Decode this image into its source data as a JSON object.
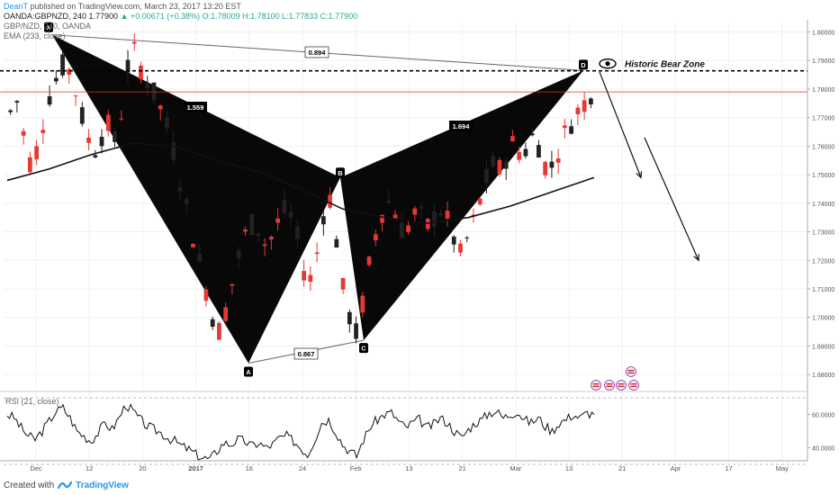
{
  "header": {
    "author": "DeanT",
    "published_text": "published on TradingView.com, March 23, 2017 13:20 EST",
    "symbol_line": "OANDA:GBPNZD, 240  1.77900",
    "change": "▲ +0.00671 (+0.38%)",
    "ohlc": "O:1.78009  H:1.78100  L:1.77833  C:1.77900",
    "symbol_name": "GBP/NZD, 240, OANDA",
    "ema_label": "EMA (233, close)"
  },
  "rsi_label": "RSI (21, close)",
  "footer": {
    "created_with": "Created with",
    "brand": "TradingView"
  },
  "colors": {
    "up": "#26a69a",
    "down": "#e53935",
    "price": "#d32f2f",
    "label_bg": "#000000"
  },
  "chart_data": {
    "type": "candlestick",
    "y_range": [
      1.675,
      1.803
    ],
    "y_ticks": [
      "1.80000",
      "1.79000",
      "1.78000",
      "1.77000",
      "1.76000",
      "1.75000",
      "1.74000",
      "1.73000",
      "1.72000",
      "1.71000",
      "1.70000",
      "1.69000",
      "1.68000"
    ],
    "x_ticks": [
      "Dec",
      "12",
      "20",
      "2017",
      "16",
      "24",
      "Feb",
      "13",
      "21",
      "Mar",
      "13",
      "21",
      "Apr",
      "17",
      "May"
    ],
    "resistance": {
      "value": 1.78638,
      "label": "1.78638",
      "text": "Historic Bear Zone"
    },
    "last_price": {
      "value": 1.779,
      "label": "1.77900",
      "timer": "2:39:36"
    },
    "pattern_points": [
      {
        "name": "X",
        "price": 1.799
      },
      {
        "name": "A",
        "price": 1.684
      },
      {
        "name": "B",
        "price": 1.749
      },
      {
        "name": "C",
        "price": 1.692
      },
      {
        "name": "D",
        "price": 1.7865
      }
    ],
    "ratios": [
      {
        "label": "0.894"
      },
      {
        "label": "1.559"
      },
      {
        "label": "0.867"
      },
      {
        "label": "1.694"
      }
    ],
    "close_path": [
      [
        0,
        1.772
      ],
      [
        1,
        1.776
      ],
      [
        2,
        1.763
      ],
      [
        3,
        1.753
      ],
      [
        4,
        1.76
      ],
      [
        5,
        1.772
      ],
      [
        6,
        1.781
      ],
      [
        7,
        1.785
      ],
      [
        8,
        1.79
      ],
      [
        9,
        1.783
      ],
      [
        10,
        1.774
      ],
      [
        11,
        1.764
      ],
      [
        12,
        1.758
      ],
      [
        13,
        1.763
      ],
      [
        14,
        1.768
      ],
      [
        15,
        1.761
      ],
      [
        16,
        1.771
      ],
      [
        17,
        1.788
      ],
      [
        18,
        1.793
      ],
      [
        19,
        1.787
      ],
      [
        20,
        1.782
      ],
      [
        21,
        1.777
      ],
      [
        22,
        1.772
      ],
      [
        23,
        1.764
      ],
      [
        24,
        1.755
      ],
      [
        25,
        1.743
      ],
      [
        26,
        1.733
      ],
      [
        27,
        1.723
      ],
      [
        28,
        1.713
      ],
      [
        29,
        1.703
      ],
      [
        30,
        1.694
      ],
      [
        31,
        1.701
      ],
      [
        32,
        1.711
      ],
      [
        33,
        1.721
      ],
      [
        34,
        1.729
      ],
      [
        35,
        1.733
      ],
      [
        36,
        1.731
      ],
      [
        37,
        1.725
      ],
      [
        38,
        1.729
      ],
      [
        39,
        1.735
      ],
      [
        40,
        1.738
      ],
      [
        41,
        1.733
      ],
      [
        42,
        1.722
      ],
      [
        43,
        1.711
      ],
      [
        44,
        1.717
      ],
      [
        45,
        1.733
      ],
      [
        46,
        1.745
      ],
      [
        47,
        1.731
      ],
      [
        48,
        1.711
      ],
      [
        49,
        1.701
      ],
      [
        50,
        1.694
      ],
      [
        51,
        1.705
      ],
      [
        52,
        1.719
      ],
      [
        53,
        1.731
      ],
      [
        54,
        1.739
      ],
      [
        55,
        1.741
      ],
      [
        56,
        1.735
      ],
      [
        57,
        1.729
      ],
      [
        58,
        1.734
      ],
      [
        59,
        1.738
      ],
      [
        60,
        1.731
      ],
      [
        61,
        1.733
      ],
      [
        62,
        1.739
      ],
      [
        63,
        1.735
      ],
      [
        64,
        1.729
      ],
      [
        65,
        1.721
      ],
      [
        66,
        1.727
      ],
      [
        67,
        1.733
      ],
      [
        68,
        1.741
      ],
      [
        69,
        1.749
      ],
      [
        70,
        1.754
      ],
      [
        71,
        1.751
      ],
      [
        72,
        1.758
      ],
      [
        73,
        1.762
      ],
      [
        74,
        1.756
      ],
      [
        75,
        1.761
      ],
      [
        76,
        1.765
      ],
      [
        77,
        1.755
      ],
      [
        78,
        1.751
      ],
      [
        79,
        1.757
      ],
      [
        80,
        1.763
      ],
      [
        81,
        1.768
      ],
      [
        82,
        1.772
      ],
      [
        83,
        1.775
      ],
      [
        84,
        1.779
      ]
    ],
    "ema_path": [
      [
        0,
        1.748
      ],
      [
        6,
        1.752
      ],
      [
        12,
        1.757
      ],
      [
        18,
        1.761
      ],
      [
        24,
        1.76
      ],
      [
        30,
        1.755
      ],
      [
        36,
        1.751
      ],
      [
        42,
        1.745
      ],
      [
        48,
        1.738
      ],
      [
        54,
        1.735
      ],
      [
        60,
        1.733
      ],
      [
        66,
        1.735
      ],
      [
        72,
        1.739
      ],
      [
        78,
        1.744
      ],
      [
        84,
        1.749
      ]
    ],
    "projection_arrows": [
      {
        "from": 1.786,
        "to": 1.749
      },
      {
        "from": 1.763,
        "to": 1.72
      }
    ],
    "rsi": {
      "range": [
        30,
        70
      ],
      "ticks": [
        "60.0000",
        "40.0000"
      ],
      "values": [
        60,
        58,
        52,
        47,
        45,
        50,
        56,
        62,
        64,
        58,
        50,
        47,
        44,
        49,
        55,
        51,
        58,
        66,
        62,
        57,
        53,
        51,
        49,
        46,
        44,
        41,
        39,
        36,
        34,
        33,
        38,
        43,
        42,
        45,
        44,
        41,
        43,
        40,
        42,
        46,
        47,
        44,
        40,
        36,
        45,
        55,
        57,
        50,
        42,
        38,
        35,
        45,
        53,
        57,
        60,
        61,
        56,
        52,
        55,
        57,
        52,
        54,
        58,
        55,
        50,
        46,
        51,
        55,
        57,
        61,
        62,
        58,
        60,
        62,
        57,
        55,
        58,
        53,
        50,
        55,
        57,
        60,
        58,
        61,
        60
      ]
    }
  }
}
